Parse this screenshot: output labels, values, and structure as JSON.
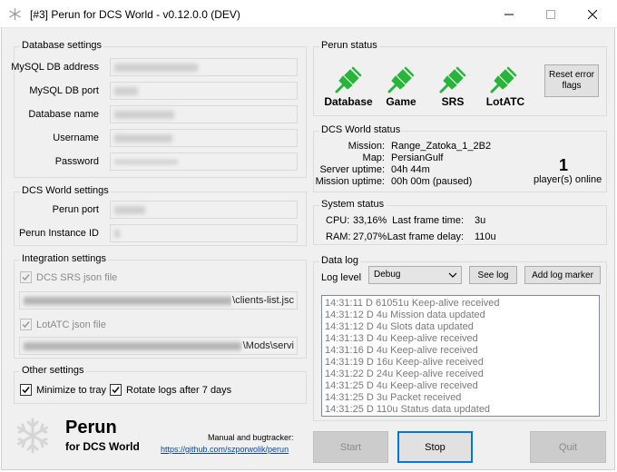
{
  "window": {
    "title": "[#3] Perun for DCS World - v0.12.0.0 (DEV)",
    "minimize_icon": "minimize-icon",
    "maximize_icon": "maximize-icon",
    "close_icon": "close-icon"
  },
  "database_settings": {
    "legend": "Database settings",
    "fields": [
      {
        "label": "MySQL DB address",
        "value": ""
      },
      {
        "label": "MySQL DB port",
        "value": ""
      },
      {
        "label": "Database name",
        "value": ""
      },
      {
        "label": "Username",
        "value": ""
      },
      {
        "label": "Password",
        "value": ""
      }
    ]
  },
  "dcs_settings": {
    "legend": "DCS World settings",
    "fields": [
      {
        "label": "Perun port",
        "value": ""
      },
      {
        "label": "Perun Instance ID",
        "value": ""
      }
    ]
  },
  "integration_settings": {
    "legend": "Integration settings",
    "srs_label": "DCS SRS json file",
    "srs_checked": true,
    "srs_path_tail": "\\clients-list.jsc",
    "lotatc_label": "LotATC json file",
    "lotatc_checked": true,
    "lotatc_path_tail": "\\Mods\\servi"
  },
  "other_settings": {
    "legend": "Other settings",
    "minimize_label": "Minimize to tray",
    "minimize_checked": true,
    "rotate_label": "Rotate logs after 7 days",
    "rotate_checked": true
  },
  "branding": {
    "name": "Perun",
    "subtitle": "for DCS World",
    "manual_label": "Manual and bugtracker:",
    "url": "https://github.com/szporwolik/perun"
  },
  "perun_status": {
    "legend": "Perun status",
    "items": [
      {
        "label": "Database",
        "icon": "plug-connected-icon",
        "color": "#27b53a"
      },
      {
        "label": "Game",
        "icon": "plug-connected-icon",
        "color": "#27b53a"
      },
      {
        "label": "SRS",
        "icon": "plug-connected-icon",
        "color": "#27b53a"
      },
      {
        "label": "LotATC",
        "icon": "plug-connected-icon",
        "color": "#27b53a"
      }
    ],
    "reset_button": "Reset error flags"
  },
  "dcs_status": {
    "legend": "DCS World status",
    "rows": [
      {
        "label": "Mission:",
        "value": "Range_Zatoka_1_2B2"
      },
      {
        "label": "Map:",
        "value": "PersianGulf"
      },
      {
        "label": "Server uptime:",
        "value": "04h 44m"
      },
      {
        "label": "Mission uptime:",
        "value": "00h 00m (paused)"
      }
    ],
    "players_count": "1",
    "players_label": "player(s) online"
  },
  "system_status": {
    "legend": "System status",
    "cpu_label": "CPU:",
    "cpu_value": "33,16%",
    "ram_label": "RAM:",
    "ram_value": "27,07%",
    "frame_time_label": "Last frame time:",
    "frame_time_value": "3u",
    "frame_delay_label": "Last frame delay:",
    "frame_delay_value": "110u"
  },
  "data_log": {
    "legend": "Data log",
    "level_label": "Log level",
    "level_value": "Debug",
    "see_log_button": "See log",
    "add_marker_button": "Add log marker",
    "lines": [
      "14:31:11 D 61051u Keep-alive received",
      "14:31:12 D 4u Mission data updated",
      "14:31:12 D 4u Slots data updated",
      "14:31:13 D 4u Keep-alive received",
      "14:31:16 D 4u Keep-alive received",
      "14:31:19 D 16u Keep-alive received",
      "14:31:22 D 24u Keep-alive received",
      "14:31:25 D 4u Keep-alive received",
      "14:31:25 D 3u Packet received",
      "14:31:25 D 110u Status data updated"
    ]
  },
  "buttons": {
    "start": "Start",
    "stop": "Stop",
    "quit": "Quit"
  }
}
